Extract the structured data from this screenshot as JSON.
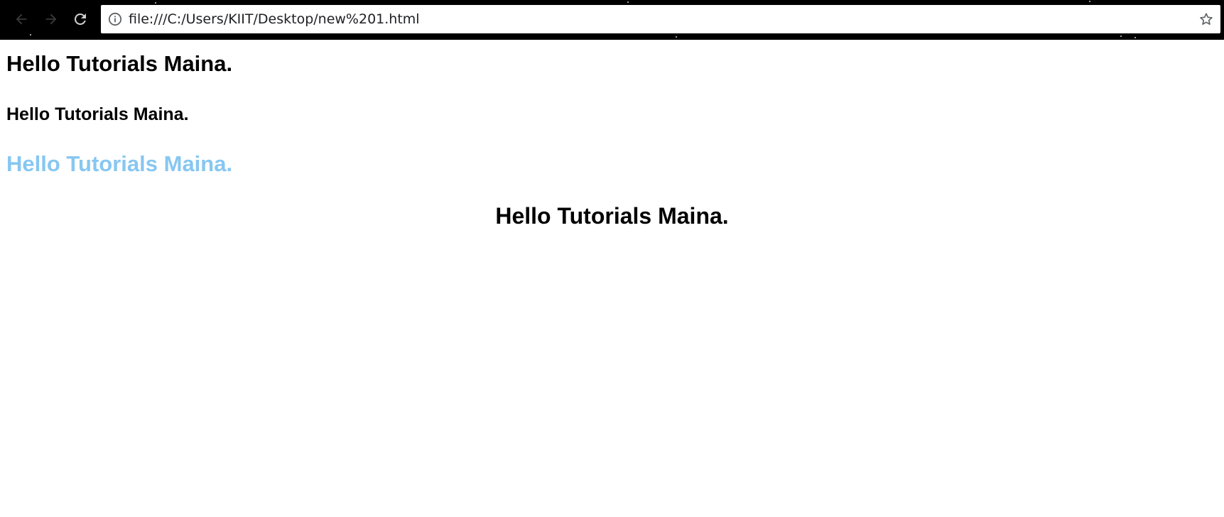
{
  "browser": {
    "url": "file:///C:/Users/KIIT/Desktop/new%201.html",
    "icons": {
      "back": "arrow-left-icon",
      "forward": "arrow-right-icon",
      "reload": "reload-icon",
      "info": "info-icon",
      "bookmark": "star-icon"
    }
  },
  "page": {
    "headings": [
      {
        "text": "Hello Tutorials Maina.",
        "color": "#000000"
      },
      {
        "text": "Hello Tutorials Maina.",
        "color": "#000000"
      },
      {
        "text": "Hello Tutorials Maina.",
        "color": "#87c7f1"
      },
      {
        "text": "Hello Tutorials Maina.",
        "color": "#000000",
        "align": "center"
      }
    ]
  }
}
